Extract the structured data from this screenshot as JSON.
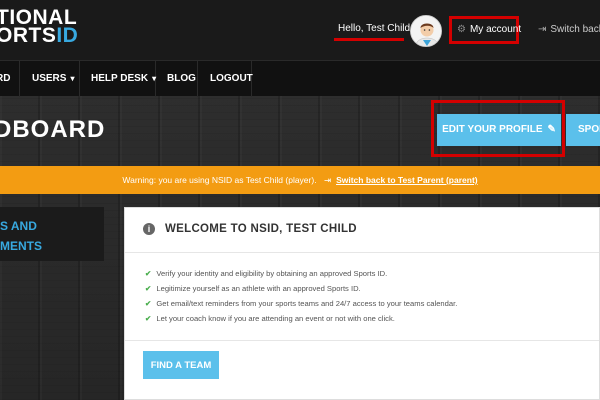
{
  "header": {
    "logo_line1": "TIONAL",
    "logo_line2_prefix": "ORTS",
    "logo_line2_accent": "ID",
    "greeting": "Hello, Test Child",
    "my_account": "My account",
    "switch_back": "Switch back"
  },
  "nav": {
    "items": [
      {
        "label": "RD"
      },
      {
        "label": "USERS"
      },
      {
        "label": "HELP DESK"
      },
      {
        "label": "BLOG"
      },
      {
        "label": "LOGOUT"
      }
    ]
  },
  "title_row": {
    "page_title": "DBOARD",
    "edit_profile": "EDIT YOUR PROFILE",
    "sports_button": "SPOR"
  },
  "warning": {
    "text": "Warning: you are using NSID as Test Child (player).",
    "link": "Switch back to Test Parent (parent)"
  },
  "side": {
    "line1": "S AND",
    "line2": "MENTS"
  },
  "welcome": {
    "title": "WELCOME TO NSID, TEST CHILD",
    "bullets": [
      "Verify your identity and eligibility by obtaining an approved Sports ID.",
      "Legitimize yourself as an athlete with an approved Sports ID.",
      "Get email/text reminders from your sports teams and 24/7 access to your teams calendar.",
      "Let your coach know if you are attending an event or not with one click."
    ],
    "find_team": "FIND A TEAM"
  },
  "colors": {
    "accent": "#5bc0eb",
    "logo_accent": "#38a9e0",
    "warning": "#f39c12",
    "annotation": "#d40000"
  },
  "icons": [
    "avatar",
    "gear-icon",
    "switch-arrow-icon",
    "chevron-down-icon",
    "pencil-icon",
    "info-icon",
    "check-icon"
  ]
}
